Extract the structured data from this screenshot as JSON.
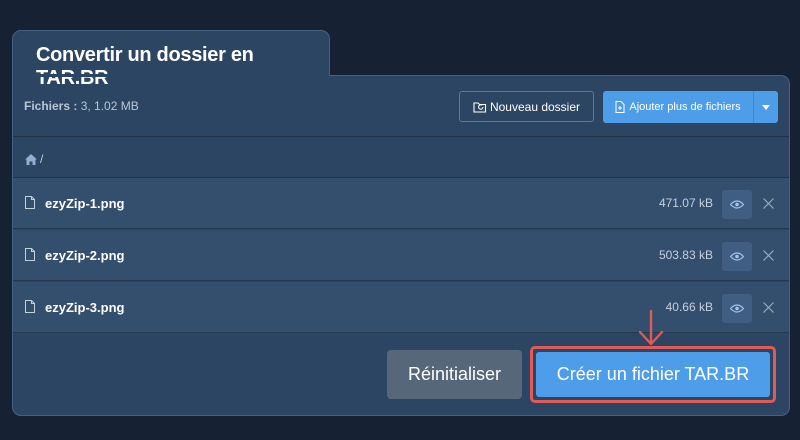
{
  "header": {
    "title": "Convertir un dossier en TAR.BR"
  },
  "toolbar": {
    "files_label": "Fichiers :",
    "files_summary": "3, 1.02 MB",
    "new_folder_label": "Nouveau dossier",
    "add_files_label": "Ajouter plus de fichiers"
  },
  "breadcrumb": {
    "separator": "/"
  },
  "files": [
    {
      "name": "ezyZip-1.png",
      "size": "471.07 kB"
    },
    {
      "name": "ezyZip-2.png",
      "size": "503.83 kB"
    },
    {
      "name": "ezyZip-3.png",
      "size": "40.66 kB"
    }
  ],
  "actions": {
    "reset_label": "Réinitialiser",
    "create_label": "Créer un fichier TAR.BR"
  },
  "colors": {
    "background": "#162233",
    "panel": "#2c4562",
    "row": "#344e6d",
    "primary": "#4d9de8",
    "secondary": "#56677a",
    "highlight": "#e05a57"
  }
}
